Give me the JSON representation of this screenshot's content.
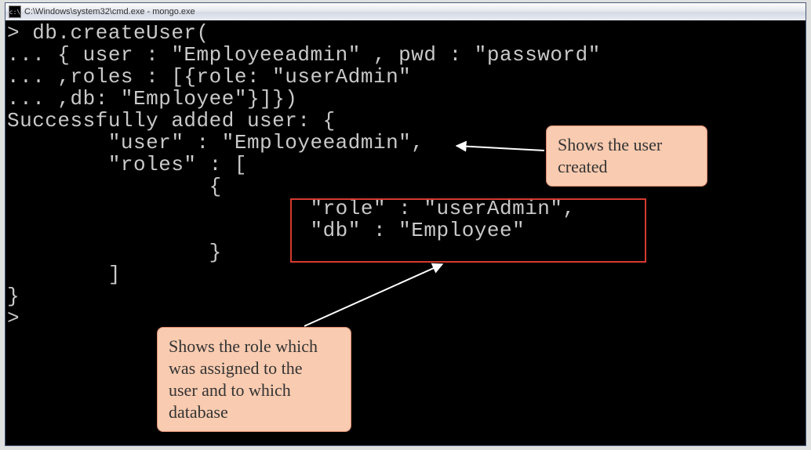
{
  "window": {
    "title": "C:\\Windows\\system32\\cmd.exe - mongo.exe",
    "icon_glyph": "c:\\"
  },
  "terminal": {
    "lines": [
      "> db.createUser(",
      "... { user : \"Employeeadmin\" , pwd : \"password\"",
      "... ,roles : [{role: \"userAdmin\"",
      "... ,db: \"Employee\"}]})",
      "Successfully added user: {",
      "        \"user\" : \"Employeeadmin\",",
      "        \"roles\" : [",
      "                {",
      "                        \"role\" : \"userAdmin\",",
      "                        \"db\" : \"Employee\"",
      "                }",
      "        ]",
      "}",
      ">"
    ]
  },
  "annotations": {
    "user_callout": "Shows the user\ncreated",
    "role_callout": "Shows the role which\nwas assigned to the\nuser and to which\ndatabase"
  }
}
